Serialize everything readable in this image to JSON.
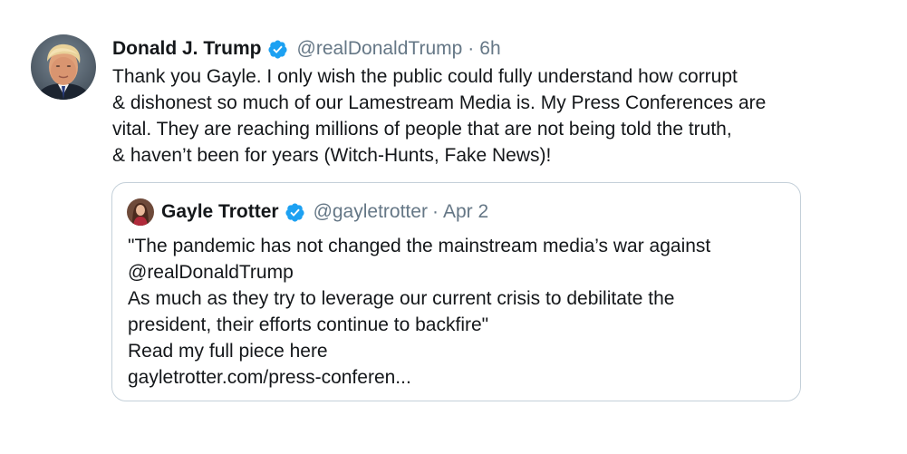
{
  "tweet": {
    "author": {
      "display_name": "Donald J. Trump",
      "handle": "@realDonaldTrump",
      "verified_icon": "verified-badge-icon"
    },
    "separator": "·",
    "time": "6h",
    "text_lines": [
      "Thank you Gayle. I only wish the public could fully understand how corrupt",
      "& dishonest so much of our Lamestream Media is. My Press Conferences are",
      "vital. They are reaching millions of people that are not being told the truth,",
      "& haven’t been for years (Witch-Hunts, Fake News)!"
    ]
  },
  "quoted_tweet": {
    "author": {
      "display_name": "Gayle Trotter",
      "handle": "@gayletrotter",
      "verified_icon": "verified-badge-icon"
    },
    "separator": "·",
    "time": "Apr 2",
    "text_lines": [
      "\"The pandemic has not changed the mainstream media’s war against",
      "@realDonaldTrump",
      "As much as they try to leverage our current crisis to debilitate the",
      "president, their efforts continue to backfire\"",
      "Read my full piece here",
      "gayletrotter.com/press-conferen..."
    ]
  },
  "colors": {
    "text_primary": "#14171a",
    "text_secondary": "#657786",
    "verified_blue": "#1da1f2",
    "border": "#c4d0d9",
    "background": "#ffffff"
  }
}
